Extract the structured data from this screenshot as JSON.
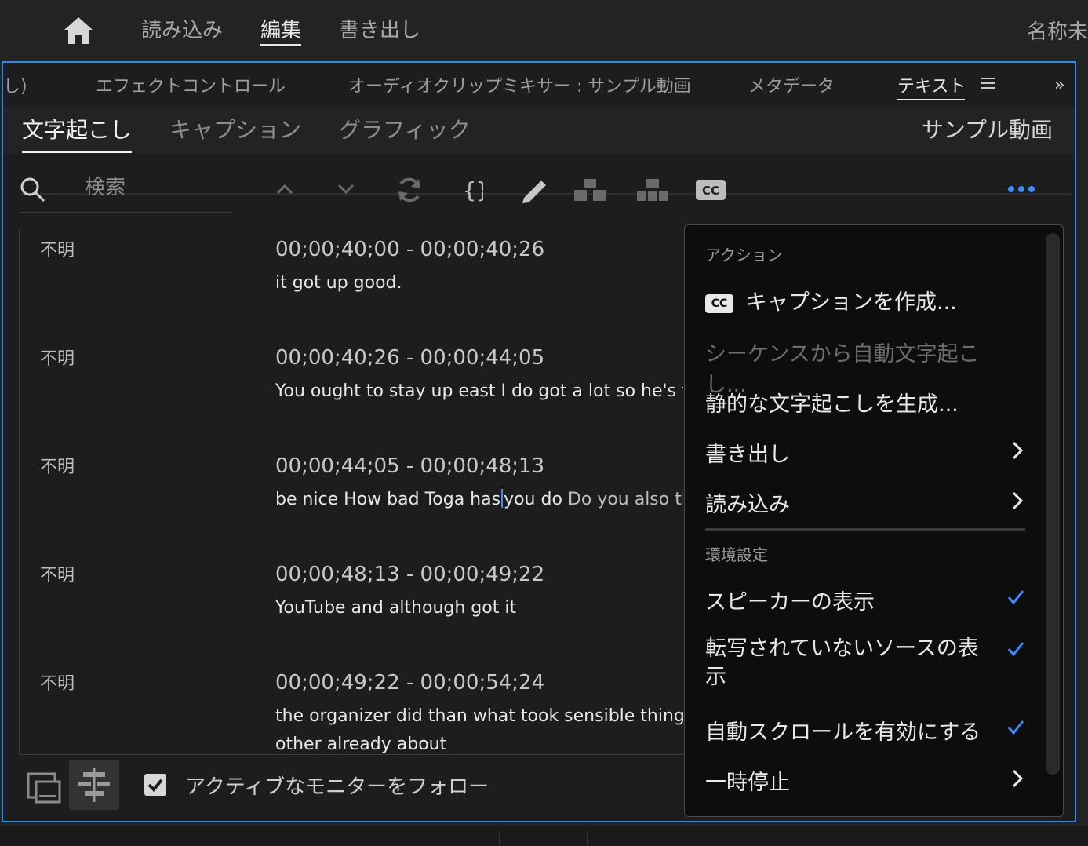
{
  "topbar": {
    "tabs": [
      "読み込み",
      "編集",
      "書き出し"
    ],
    "active_tab": "編集",
    "project_name": "名称未"
  },
  "panel_tabs": {
    "cut_left": "し)",
    "items": [
      "エフェクトコントロール",
      "オーディオクリップミキサー : サンプル動画",
      "メタデータ",
      "テキスト"
    ],
    "active": "テキスト",
    "overflow": "»"
  },
  "subtabs": {
    "items": [
      "文字起こし",
      "キャプション",
      "グラフィック"
    ],
    "active": "文字起こし",
    "sequence_name": "サンプル動画"
  },
  "search": {
    "placeholder": "検索"
  },
  "toolbar_icons": [
    "chevron-up-icon",
    "chevron-down-icon",
    "refresh-icon",
    "merge-icon",
    "pencil-icon",
    "split-speaker-icon",
    "assign-speaker-icon",
    "cc-icon",
    "more-icon"
  ],
  "segments": [
    {
      "speaker": "不明",
      "timecode": "00;00;40;00 - 00;00;40;26",
      "text": "it got up good."
    },
    {
      "speaker": "不明",
      "timecode": "00;00;40;26 - 00;00;44;05",
      "text": "You ought to stay up east I do got a lot so he's taken my"
    },
    {
      "speaker": "不明",
      "timecode": "00;00;44;05 - 00;00;48;13",
      "text_before_caret": "be nice How bad Toga has",
      "text_after_caret": "you do",
      "text_dim": "Do you also the cop v"
    },
    {
      "speaker": "不明",
      "timecode": "00;00;48;13 - 00;00;49;22",
      "text": "YouTube and although got it"
    },
    {
      "speaker": "不明",
      "timecode": "00;00;49;22 - 00;00;54;24",
      "text": "the organizer did than what took sensible thing out of th",
      "text2": "other already about"
    }
  ],
  "footer": {
    "follow_label": "アクティブなモニターをフォロー",
    "follow_checked": true
  },
  "menu": {
    "section_actions": "アクション",
    "create_captions": "キャプションを作成...",
    "auto_transcribe": "シーケンスから自動文字起こし...",
    "generate_static": "静的な文字起こしを生成...",
    "export": "書き出し",
    "import": "読み込み",
    "section_prefs": "環境設定",
    "show_speakers": "スピーカーの表示",
    "show_untranscribed": "転写されていないソースの表示",
    "auto_scroll": "自動スクロールを有効にする",
    "pause": "一時停止",
    "cc_label": "CC",
    "accent": "#3b8cff"
  },
  "colors": {
    "panel_border": "#2d8ceb",
    "accent": "#3b8cff"
  }
}
